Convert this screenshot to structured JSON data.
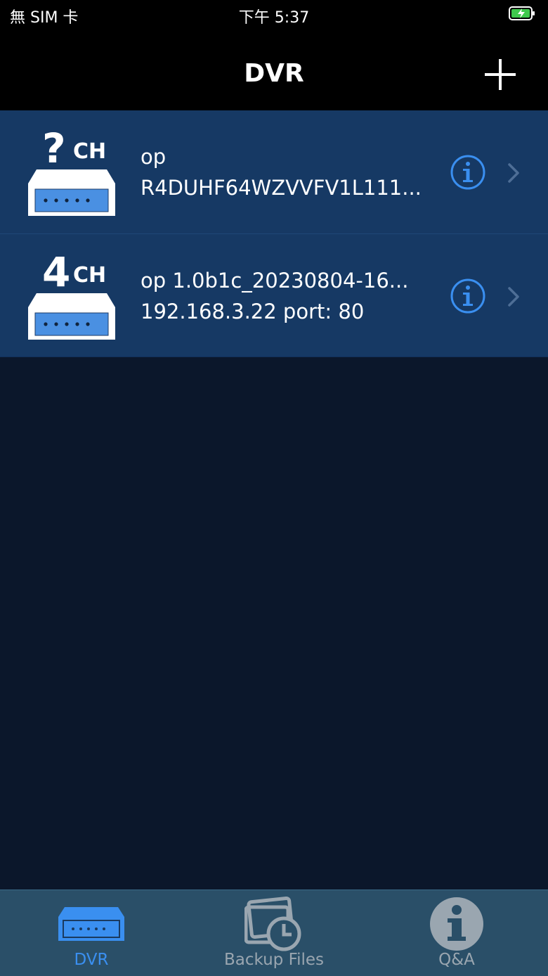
{
  "status_bar": {
    "carrier": "無 SIM 卡",
    "time": "下午 5:37"
  },
  "nav": {
    "title": "DVR",
    "add_icon": "plus-icon"
  },
  "devices": [
    {
      "channel": "?",
      "channel_suffix": "CH",
      "line1": "op",
      "line2": "R4DUHF64WZVVFV1L111..."
    },
    {
      "channel": "4",
      "channel_suffix": "CH",
      "line1": "op 1.0b1c_20230804-16...",
      "line2": "192.168.3.22 port: 80"
    }
  ],
  "tabs": [
    {
      "label": "DVR",
      "icon": "dvr-icon",
      "active": true
    },
    {
      "label": "Backup Files",
      "icon": "backup-files-icon",
      "active": false
    },
    {
      "label": "Q&A",
      "icon": "info-icon",
      "active": false
    }
  ],
  "colors": {
    "accent": "#3a8ff0",
    "row_bg": "#163964",
    "page_bg": "#0b172b",
    "tab_bg": "#2a4f68",
    "tab_inactive": "#9aa6b0"
  }
}
